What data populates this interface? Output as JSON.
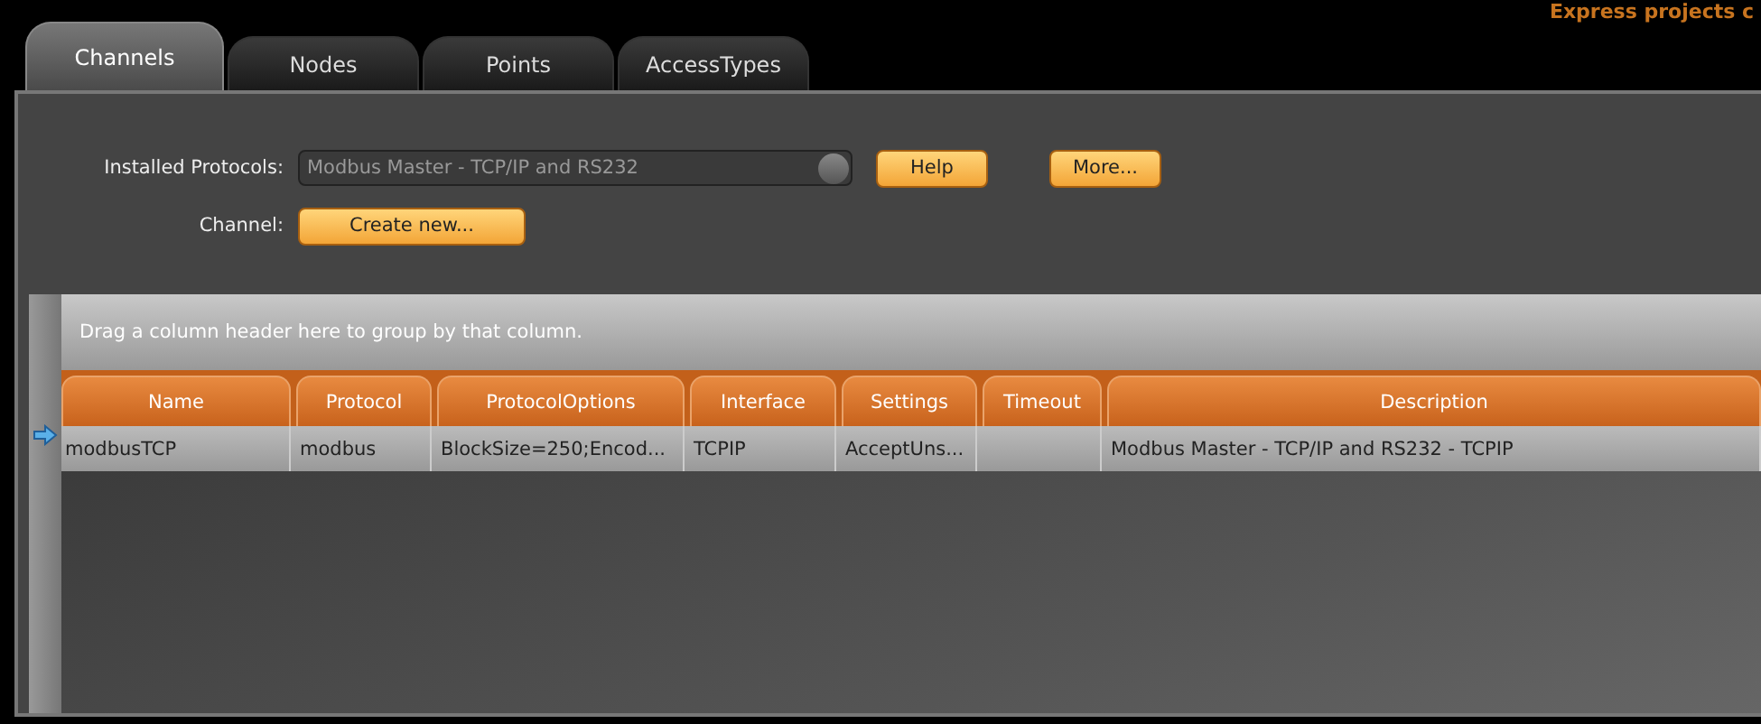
{
  "header_note": "Express projects c",
  "tabs": [
    {
      "label": "Channels",
      "selected": true
    },
    {
      "label": "Nodes",
      "selected": false
    },
    {
      "label": "Points",
      "selected": false
    },
    {
      "label": "AccessTypes",
      "selected": false
    }
  ],
  "form": {
    "protocol_label": "Installed Protocols:",
    "protocol_value": "Modbus Master - TCP/IP and RS232",
    "help_button": "Help",
    "more_button": "More...",
    "channel_label": "Channel:",
    "create_button": "Create new..."
  },
  "grid": {
    "group_hint": "Drag a column header here to group by that column.",
    "columns": [
      "Name",
      "Protocol",
      "ProtocolOptions",
      "Interface",
      "Settings",
      "Timeout",
      "Description"
    ],
    "rows": [
      {
        "selected": true,
        "cells": [
          "modbusTCP",
          "modbus",
          "BlockSize=250;Encod...",
          "TCPIP",
          "AcceptUns...",
          "",
          "Modbus Master - TCP/IP and RS232 - TCPIP"
        ]
      }
    ]
  }
}
